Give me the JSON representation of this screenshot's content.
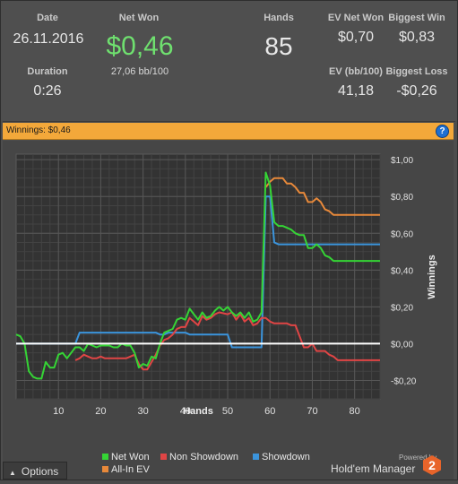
{
  "stats": {
    "date": {
      "label": "Date",
      "value": "26.11.2016"
    },
    "net_won": {
      "label": "Net Won",
      "value": "$0,46",
      "sub": "27,06 bb/100"
    },
    "hands": {
      "label": "Hands",
      "value": "85"
    },
    "ev_net_won": {
      "label": "EV Net Won",
      "value": "$0,70"
    },
    "biggest_win": {
      "label": "Biggest Win",
      "value": "$0,83"
    },
    "duration": {
      "label": "Duration",
      "value": "0:26"
    },
    "ev_bb100": {
      "label": "EV (bb/100)",
      "value": "41,18"
    },
    "biggest_loss": {
      "label": "Biggest Loss",
      "value": "-$0,26"
    }
  },
  "panel": {
    "title": "Winnings: $0,46",
    "help": "?"
  },
  "options_label": "Options",
  "powered_by": "Powered by",
  "brand": "Hold'em Manager",
  "brand_logo": "2",
  "colors": {
    "net_won": "#35d435",
    "non_showdown": "#e04545",
    "showdown": "#3b94dc",
    "all_in_ev": "#e8893a",
    "header_bar": "#f3a83a"
  },
  "chart_data": {
    "type": "line",
    "xlabel": "Hands",
    "ylabel": "Winnings",
    "x_ticks": [
      10,
      20,
      30,
      40,
      50,
      60,
      70,
      80
    ],
    "y_ticks": [
      -0.2,
      0,
      0.2,
      0.4,
      0.6,
      0.8,
      1.0
    ],
    "y_tick_labels": [
      "-$0,20",
      "$0,00",
      "$0,20",
      "$0,40",
      "$0,60",
      "$0,80",
      "$1,00"
    ],
    "xlim": [
      0,
      86
    ],
    "ylim": [
      -0.3,
      1.03
    ],
    "grid": true,
    "legend_position": "bottom",
    "series": [
      {
        "name": "Net Won",
        "color": "#35d435",
        "points": [
          [
            0,
            0.05
          ],
          [
            1,
            0.04
          ],
          [
            2,
            0.0
          ],
          [
            3,
            -0.15
          ],
          [
            4,
            -0.18
          ],
          [
            5,
            -0.19
          ],
          [
            6,
            -0.19
          ],
          [
            7,
            -0.1
          ],
          [
            8,
            -0.13
          ],
          [
            9,
            -0.13
          ],
          [
            10,
            -0.06
          ],
          [
            11,
            -0.05
          ],
          [
            12,
            -0.08
          ],
          [
            13,
            -0.05
          ],
          [
            14,
            -0.02
          ],
          [
            15,
            -0.02
          ],
          [
            16,
            -0.04
          ],
          [
            17,
            0.0
          ],
          [
            18,
            -0.01
          ],
          [
            19,
            -0.02
          ],
          [
            20,
            -0.01
          ],
          [
            21,
            -0.01
          ],
          [
            22,
            -0.01
          ],
          [
            23,
            -0.02
          ],
          [
            24,
            -0.02
          ],
          [
            25,
            0.0
          ],
          [
            26,
            -0.01
          ],
          [
            27,
            -0.01
          ],
          [
            28,
            -0.05
          ],
          [
            29,
            -0.13
          ],
          [
            30,
            -0.11
          ],
          [
            31,
            -0.12
          ],
          [
            32,
            -0.07
          ],
          [
            33,
            -0.08
          ],
          [
            34,
            0.0
          ],
          [
            35,
            0.06
          ],
          [
            36,
            0.07
          ],
          [
            37,
            0.08
          ],
          [
            38,
            0.13
          ],
          [
            39,
            0.14
          ],
          [
            40,
            0.13
          ],
          [
            41,
            0.19
          ],
          [
            42,
            0.16
          ],
          [
            43,
            0.13
          ],
          [
            44,
            0.17
          ],
          [
            45,
            0.14
          ],
          [
            46,
            0.15
          ],
          [
            47,
            0.18
          ],
          [
            48,
            0.2
          ],
          [
            49,
            0.18
          ],
          [
            50,
            0.2
          ],
          [
            51,
            0.17
          ],
          [
            52,
            0.15
          ],
          [
            53,
            0.17
          ],
          [
            54,
            0.14
          ],
          [
            55,
            0.17
          ],
          [
            56,
            0.12
          ],
          [
            57,
            0.13
          ],
          [
            58,
            0.17
          ],
          [
            59,
            0.93
          ],
          [
            60,
            0.86
          ],
          [
            61,
            0.66
          ],
          [
            62,
            0.64
          ],
          [
            63,
            0.64
          ],
          [
            64,
            0.63
          ],
          [
            65,
            0.62
          ],
          [
            66,
            0.6
          ],
          [
            67,
            0.59
          ],
          [
            68,
            0.59
          ],
          [
            69,
            0.52
          ],
          [
            70,
            0.52
          ],
          [
            71,
            0.54
          ],
          [
            72,
            0.52
          ],
          [
            73,
            0.48
          ],
          [
            74,
            0.47
          ],
          [
            75,
            0.45
          ],
          [
            86,
            0.45
          ]
        ]
      },
      {
        "name": "Non Showdown",
        "color": "#e04545",
        "points": [
          [
            14,
            -0.09
          ],
          [
            15,
            -0.08
          ],
          [
            16,
            -0.06
          ],
          [
            17,
            -0.07
          ],
          [
            18,
            -0.08
          ],
          [
            19,
            -0.08
          ],
          [
            20,
            -0.07
          ],
          [
            21,
            -0.08
          ],
          [
            26,
            -0.08
          ],
          [
            27,
            -0.07
          ],
          [
            28,
            -0.06
          ],
          [
            29,
            -0.11
          ],
          [
            30,
            -0.14
          ],
          [
            31,
            -0.14
          ],
          [
            32,
            -0.1
          ],
          [
            33,
            -0.06
          ],
          [
            34,
            -0.01
          ],
          [
            35,
            0.02
          ],
          [
            36,
            0.03
          ],
          [
            37,
            0.05
          ],
          [
            38,
            0.08
          ],
          [
            39,
            0.09
          ],
          [
            40,
            0.09
          ],
          [
            41,
            0.14
          ],
          [
            42,
            0.12
          ],
          [
            43,
            0.1
          ],
          [
            44,
            0.15
          ],
          [
            45,
            0.13
          ],
          [
            46,
            0.14
          ],
          [
            47,
            0.16
          ],
          [
            48,
            0.17
          ],
          [
            50,
            0.16
          ],
          [
            51,
            0.17
          ],
          [
            52,
            0.13
          ],
          [
            53,
            0.16
          ],
          [
            54,
            0.12
          ],
          [
            55,
            0.14
          ],
          [
            56,
            0.1
          ],
          [
            57,
            0.11
          ],
          [
            58,
            0.14
          ],
          [
            59,
            0.14
          ],
          [
            60,
            0.12
          ],
          [
            61,
            0.11
          ],
          [
            62,
            0.11
          ],
          [
            63,
            0.11
          ],
          [
            64,
            0.11
          ],
          [
            65,
            0.1
          ],
          [
            66,
            0.1
          ],
          [
            67,
            0.04
          ],
          [
            68,
            -0.02
          ],
          [
            69,
            -0.02
          ],
          [
            70,
            0.0
          ],
          [
            71,
            -0.04
          ],
          [
            72,
            -0.04
          ],
          [
            73,
            -0.04
          ],
          [
            74,
            -0.06
          ],
          [
            75,
            -0.07
          ],
          [
            76,
            -0.09
          ],
          [
            86,
            -0.09
          ]
        ]
      },
      {
        "name": "Showdown",
        "color": "#3b94dc",
        "points": [
          [
            0,
            0.0
          ],
          [
            14,
            0.0
          ],
          [
            15,
            0.06
          ],
          [
            33,
            0.06
          ],
          [
            34,
            0.05
          ],
          [
            35,
            0.05
          ],
          [
            36,
            0.06
          ],
          [
            40,
            0.06
          ],
          [
            41,
            0.05
          ],
          [
            48,
            0.05
          ],
          [
            49,
            0.05
          ],
          [
            50,
            0.05
          ],
          [
            51,
            -0.02
          ],
          [
            58,
            -0.02
          ],
          [
            59,
            0.8
          ],
          [
            60,
            0.8
          ],
          [
            61,
            0.55
          ],
          [
            62,
            0.54
          ],
          [
            86,
            0.54
          ]
        ]
      },
      {
        "name": "All-In EV",
        "color": "#e8893a",
        "points": [
          [
            59,
            0.85
          ],
          [
            60,
            0.88
          ],
          [
            61,
            0.9
          ],
          [
            62,
            0.9
          ],
          [
            63,
            0.9
          ],
          [
            64,
            0.87
          ],
          [
            65,
            0.87
          ],
          [
            66,
            0.85
          ],
          [
            67,
            0.82
          ],
          [
            68,
            0.82
          ],
          [
            69,
            0.77
          ],
          [
            70,
            0.77
          ],
          [
            71,
            0.79
          ],
          [
            72,
            0.77
          ],
          [
            73,
            0.73
          ],
          [
            74,
            0.72
          ],
          [
            75,
            0.7
          ],
          [
            86,
            0.7
          ]
        ]
      }
    ]
  }
}
